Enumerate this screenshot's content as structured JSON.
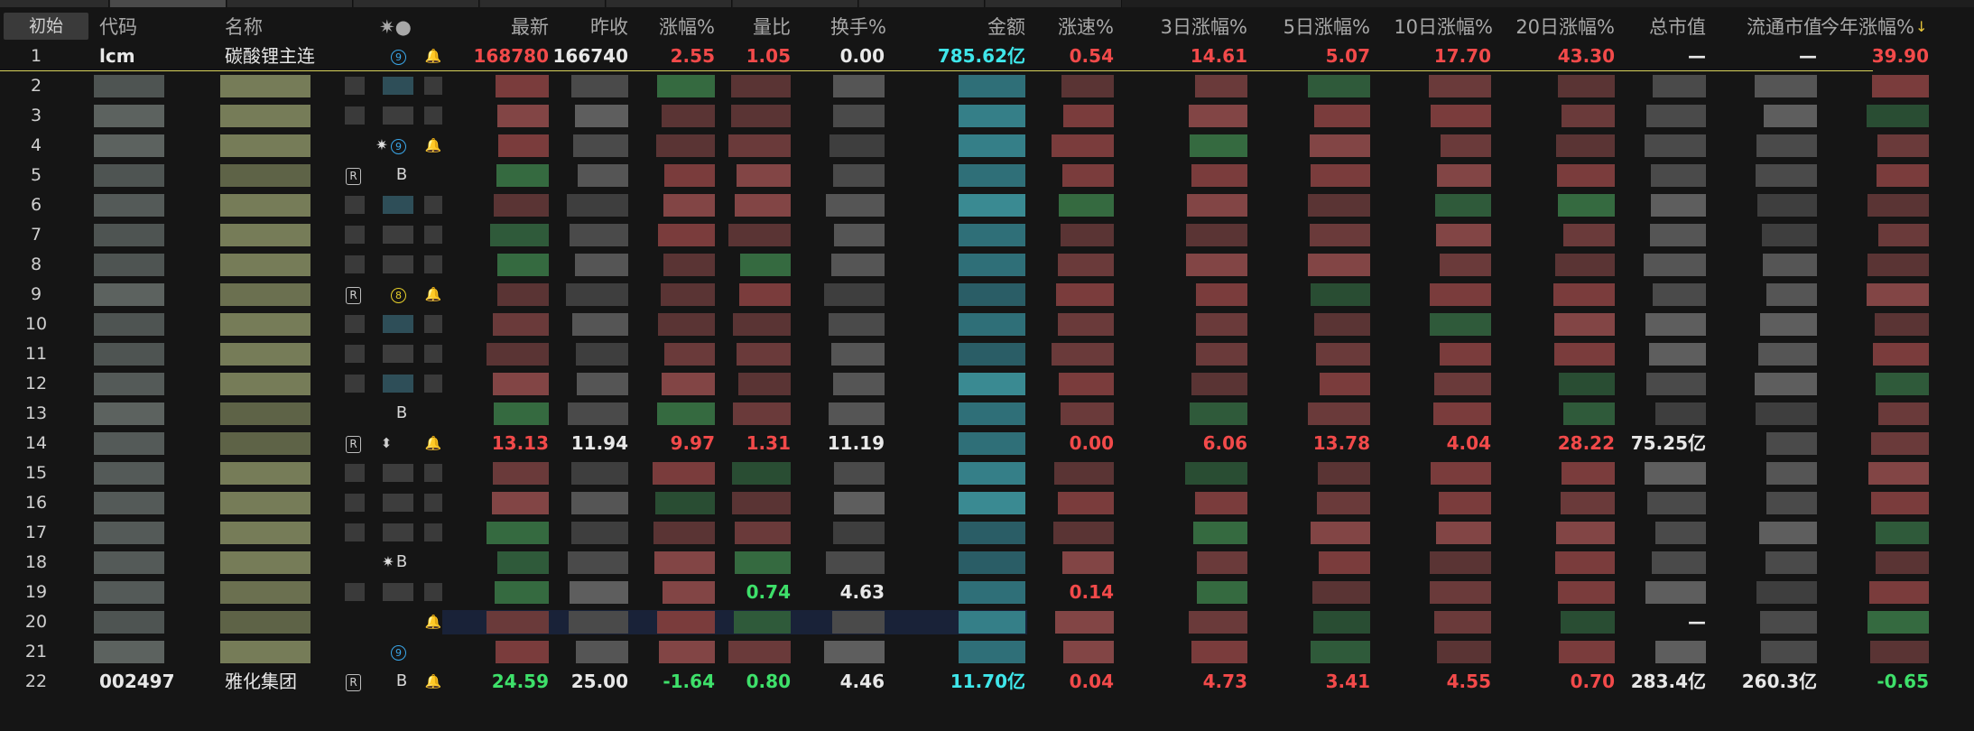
{
  "header": {
    "reset": "初始",
    "code": "代码",
    "name": "名称",
    "flags": "✷●",
    "latest": "最新",
    "prev_close": "昨收",
    "change_pct": "涨幅%",
    "volume_ratio": "量比",
    "turnover": "换手%",
    "amount": "金额",
    "speed": "涨速%",
    "chg3": "3日涨幅%",
    "chg5": "5日涨幅%",
    "chg10": "10日涨幅%",
    "chg20": "20日涨幅%",
    "mktcap": "总市值",
    "float_cap": "流通市值",
    "ytd": "今年涨幅%",
    "sort_arrow": "↓"
  },
  "rows": [
    {
      "idx": "1",
      "code": "lcm",
      "name": "碳酸锂主连",
      "latest": "168780",
      "prev": "166740",
      "chg": "2.55",
      "vr": "1.05",
      "to": "0.00",
      "amt": "785.62亿",
      "spd": "0.54",
      "c3": "14.61",
      "c5": "5.07",
      "c10": "17.70",
      "c20": "43.30",
      "mc": "—",
      "fc": "—",
      "ytd": "39.90"
    },
    {
      "idx": "2"
    },
    {
      "idx": "3"
    },
    {
      "idx": "4"
    },
    {
      "idx": "5"
    },
    {
      "idx": "6"
    },
    {
      "idx": "7"
    },
    {
      "idx": "8"
    },
    {
      "idx": "9"
    },
    {
      "idx": "10"
    },
    {
      "idx": "11"
    },
    {
      "idx": "12"
    },
    {
      "idx": "13"
    },
    {
      "idx": "14",
      "latest": "13.13",
      "prev": "11.94",
      "chg": "9.97",
      "vr": "1.31",
      "to": "11.19",
      "spd": "0.00",
      "c3": "6.06",
      "c5": "13.78",
      "c10": "4.04",
      "c20": "28.22",
      "mc": "75.25亿"
    },
    {
      "idx": "15"
    },
    {
      "idx": "16"
    },
    {
      "idx": "17"
    },
    {
      "idx": "18"
    },
    {
      "idx": "19",
      "vr": "0.74",
      "to": "4.63",
      "spd": "0.14"
    },
    {
      "idx": "20",
      "mc": "—"
    },
    {
      "idx": "21"
    },
    {
      "idx": "22",
      "code": "002497",
      "name": "雅化集团",
      "latest": "24.59",
      "prev": "25.00",
      "chg": "-1.64",
      "vr": "0.80",
      "to": "4.46",
      "amt": "11.70亿",
      "spd": "0.04",
      "c3": "4.73",
      "c5": "3.41",
      "c10": "4.55",
      "c20": "0.70",
      "mc": "283.4亿",
      "fc": "260.3亿",
      "ytd": "-0.65"
    }
  ],
  "icons": {
    "r_badge": "R",
    "nine": "⑨",
    "eight": "⑧",
    "b_letter": "B",
    "star": "✷",
    "bell": "🔔",
    "swap": "⬍"
  },
  "colors": {
    "up": "#f24a4a",
    "down": "#3ee06a",
    "amount": "#3fe6ea",
    "name": "#ece68a",
    "selected_line": "#d8d25a"
  }
}
